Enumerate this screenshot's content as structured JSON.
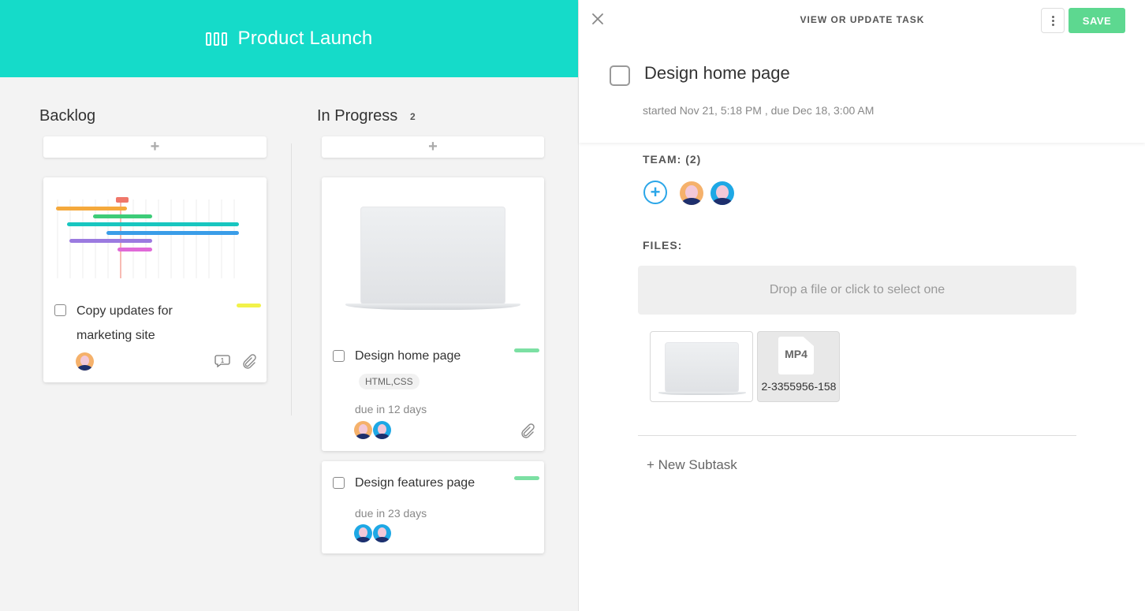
{
  "board": {
    "title": "Product Launch",
    "header_color": "#15dbc9"
  },
  "columns": [
    {
      "title": "Backlog",
      "count": "",
      "add_label": "+",
      "cards": [
        {
          "title_line1": "Copy updates for",
          "title_line2": "marketing site",
          "tag_color": "#f2f24a",
          "comment_count": "1",
          "thumbnail": "gantt-chart"
        }
      ]
    },
    {
      "title": "In Progress",
      "count": "2",
      "add_label": "+",
      "cards": [
        {
          "title": "Design home page",
          "label_chip": "HTML,CSS",
          "due": "due in 12 days",
          "tag_color": "#7ce0a3",
          "thumbnail": "laptop"
        },
        {
          "title": "Design features page",
          "due": "due in 23 days",
          "tag_color": "#7ce0a3"
        }
      ]
    }
  ],
  "panel": {
    "heading": "VIEW OR UPDATE TASK",
    "save_label": "SAVE",
    "task_title": "Design home page",
    "dates": "started Nov 21, 5:18 PM ,  due Dec 18, 3:00 AM",
    "team_label": "TEAM: (2)",
    "files_label": "FILES:",
    "dropzone_text": "Drop a file or click to select one",
    "files": [
      {
        "type": "image",
        "name": "laptop"
      },
      {
        "type": "MP4",
        "name": "2-3355956-158"
      }
    ],
    "new_subtask": "+ New Subtask"
  },
  "colors": {
    "save": "#5dd890",
    "add_member": "#2ba6e8"
  }
}
